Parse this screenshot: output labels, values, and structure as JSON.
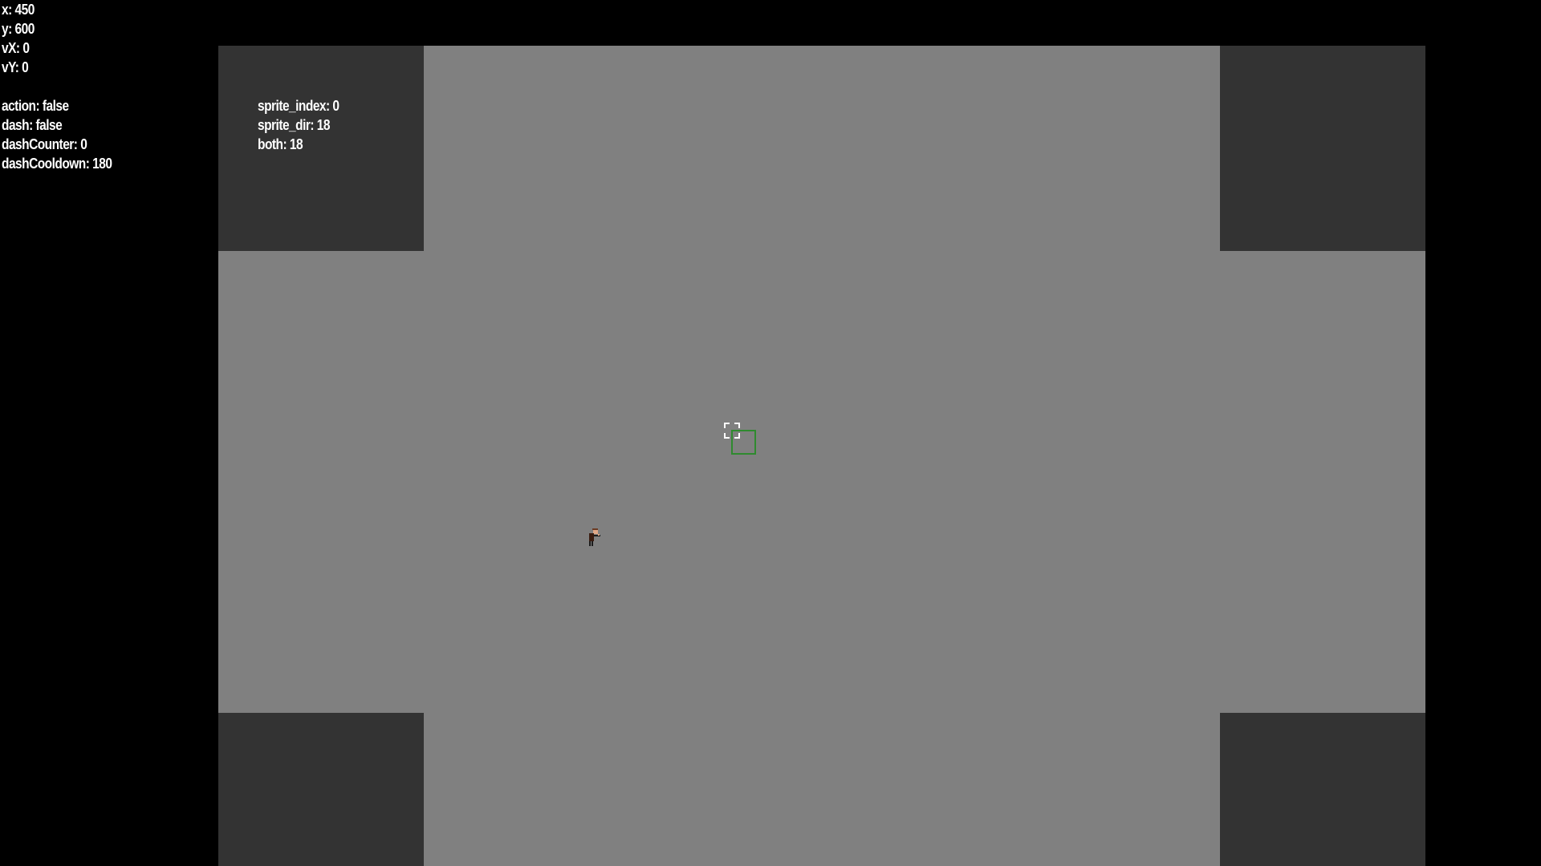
{
  "debug": {
    "x": "x: 450",
    "y": "y: 600",
    "vx": "vX: 0",
    "vy": "vY: 0",
    "action": "action: false",
    "dash": "dash: false",
    "dash_counter": "dashCounter: 0",
    "dash_cooldown": "dashCooldown: 180"
  },
  "sprite_debug": {
    "sprite_index": "sprite_index: 0",
    "sprite_dir": "sprite_dir: 18",
    "both": "both: 18"
  },
  "colors": {
    "background": "#000000",
    "floor": "#808080",
    "wall": "#333333",
    "text": "#ffffff",
    "target_outline": "#2f8a2f",
    "crosshair": "#ffffff"
  },
  "icons": {
    "crosshair": "crosshair-icon",
    "player": "player-sprite",
    "target": "target-box"
  }
}
